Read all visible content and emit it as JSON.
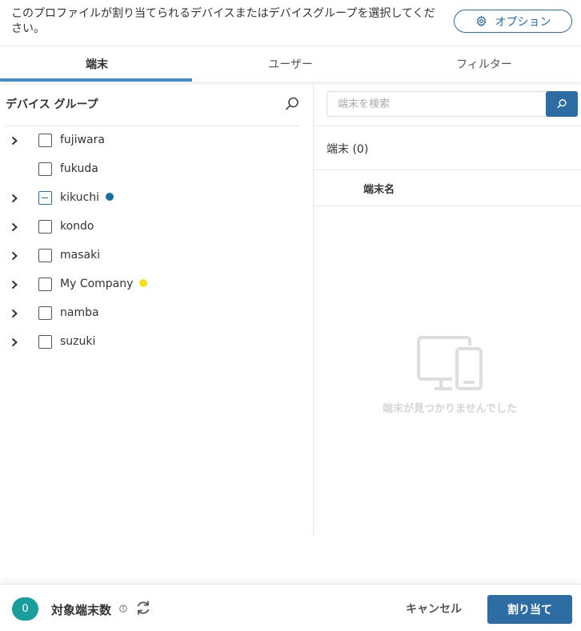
{
  "header": {
    "instruction": "このプロファイルが割り当てられるデバイスまたはデバイスグループを選択してください。",
    "options_label": "オプション"
  },
  "tabs": [
    {
      "label": "端末",
      "active": true
    },
    {
      "label": "ユーザー",
      "active": false
    },
    {
      "label": "フィルター",
      "active": false
    }
  ],
  "left": {
    "title": "デバイス グループ",
    "groups": [
      {
        "label": "fujiwara",
        "expandable": true,
        "state": "unchecked"
      },
      {
        "label": "fukuda",
        "expandable": false,
        "state": "unchecked"
      },
      {
        "label": "kikuchi",
        "expandable": true,
        "state": "partial",
        "dot_color": "#1a6fa3"
      },
      {
        "label": "kondo",
        "expandable": true,
        "state": "unchecked"
      },
      {
        "label": "masaki",
        "expandable": true,
        "state": "unchecked"
      },
      {
        "label": "My Company",
        "expandable": true,
        "state": "unchecked",
        "dot_color": "#f5e11a"
      },
      {
        "label": "namba",
        "expandable": true,
        "state": "unchecked"
      },
      {
        "label": "suzuki",
        "expandable": true,
        "state": "unchecked"
      }
    ]
  },
  "right": {
    "search_placeholder": "端末を検索",
    "device_count_label": "端末 (0)",
    "column_header": "端末名",
    "empty_message": "端末が見つかりませんでした"
  },
  "footer": {
    "count": "0",
    "label": "対象端末数",
    "cancel_label": "キャンセル",
    "assign_label": "割り当て"
  },
  "colors": {
    "primary": "#2d6da3",
    "tab_indicator": "#4a8cc4",
    "badge": "#199e9b"
  }
}
